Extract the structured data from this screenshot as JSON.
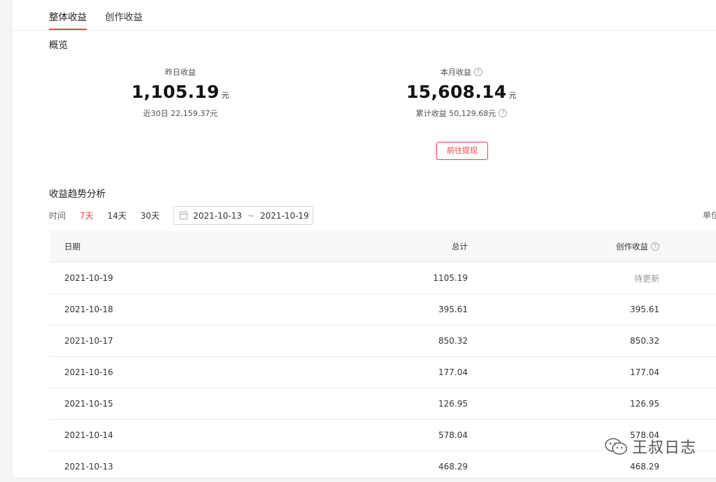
{
  "tabs": [
    {
      "label": "整体收益",
      "active": true
    },
    {
      "label": "创作收益",
      "active": false
    }
  ],
  "overview": {
    "title": "概览",
    "yesterday": {
      "label": "昨日收益",
      "value": "1,105.19",
      "unit": "元",
      "sub": "近30日 22,159.37元"
    },
    "month": {
      "label": "本月收益",
      "value": "15,608.14",
      "unit": "元",
      "sub": "累计收益 50,129.68元"
    },
    "withdraw_label": "前往提现"
  },
  "trend": {
    "title": "收益趋势分析",
    "time_label": "时间",
    "ranges": [
      {
        "label": "7天",
        "active": true
      },
      {
        "label": "14天",
        "active": false
      },
      {
        "label": "30天",
        "active": false
      }
    ],
    "date_start": "2021-10-13",
    "date_sep": "~",
    "date_end": "2021-10-19",
    "unit_label": "单位"
  },
  "table": {
    "headers": {
      "date": "日期",
      "total": "总计",
      "creation": "创作收益"
    },
    "rows": [
      {
        "date": "2021-10-19",
        "total": "1105.19",
        "creation": "待更新",
        "pending": true
      },
      {
        "date": "2021-10-18",
        "total": "395.61",
        "creation": "395.61"
      },
      {
        "date": "2021-10-17",
        "total": "850.32",
        "creation": "850.32"
      },
      {
        "date": "2021-10-16",
        "total": "177.04",
        "creation": "177.04"
      },
      {
        "date": "2021-10-15",
        "total": "126.95",
        "creation": "126.95"
      },
      {
        "date": "2021-10-14",
        "total": "578.04",
        "creation": "578.04"
      },
      {
        "date": "2021-10-13",
        "total": "468.29",
        "creation": "468.29"
      }
    ]
  },
  "watermark": {
    "text": "王叔日志",
    "icon": "wechat-icon"
  },
  "colors": {
    "accent": "#f04142",
    "header_bg": "#f7f8fa",
    "divider": "#ececec"
  }
}
